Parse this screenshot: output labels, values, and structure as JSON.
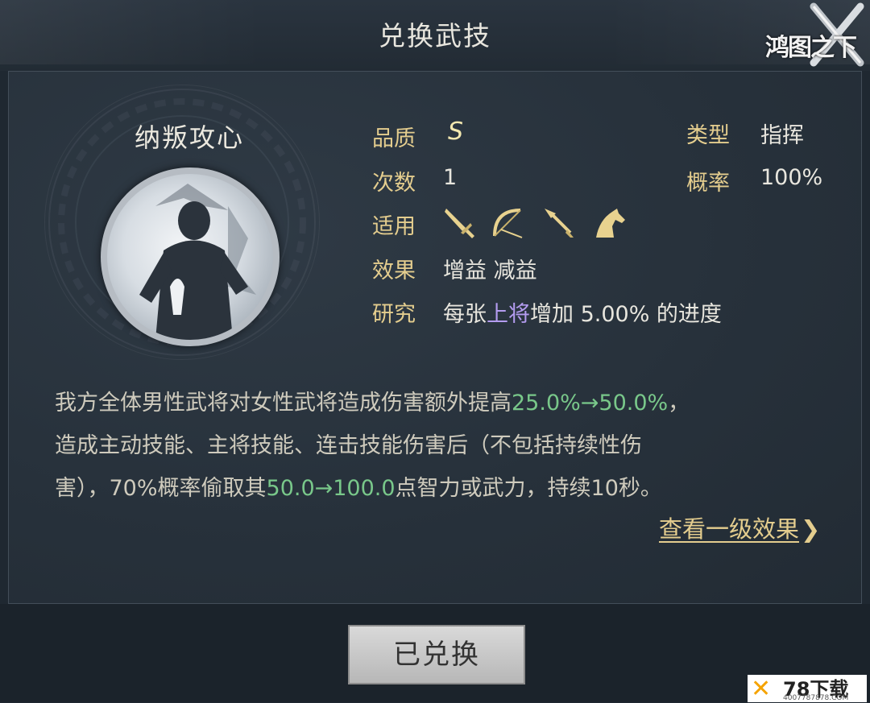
{
  "header": {
    "title": "兑换武技",
    "logo_text": "鸿图之下"
  },
  "skill": {
    "name": "纳叛攻心",
    "quality_label": "品质",
    "quality_value": "S",
    "count_label": "次数",
    "count_value": "1",
    "type_label": "类型",
    "type_value": "指挥",
    "rate_label": "概率",
    "rate_value": "100%",
    "applicable_label": "适用",
    "applicable_icons": [
      "sword-icon",
      "bow-icon",
      "spear-icon",
      "horse-icon"
    ],
    "effect_label": "效果",
    "effect_value": "增益 减益",
    "research_label": "研究",
    "research_pre": "每张",
    "research_hl": "上将",
    "research_post": "增加 5.00% 的进度"
  },
  "description": {
    "l1_a": "我方全体男性武将对女性武将造成伤害额外提高",
    "l1_b": "25.0%→50.0%",
    "l1_c": "，",
    "l2": "造成主动技能、主将技能、连击技能伤害后（不包括持续性伤",
    "l3_a": "害），70%概率偷取其",
    "l3_b": "50.0→100.0",
    "l3_c": "点智力或武力，持续10秒。"
  },
  "link": {
    "label": "查看一级效果",
    "chevron": "❯"
  },
  "button": {
    "label": "已兑换"
  },
  "watermark": {
    "big": "78下载",
    "small": "4007787878.COM"
  },
  "colors": {
    "label_gold": "#e4cd8e",
    "highlight_green": "#79c88a",
    "highlight_purple": "#b49cf0"
  }
}
